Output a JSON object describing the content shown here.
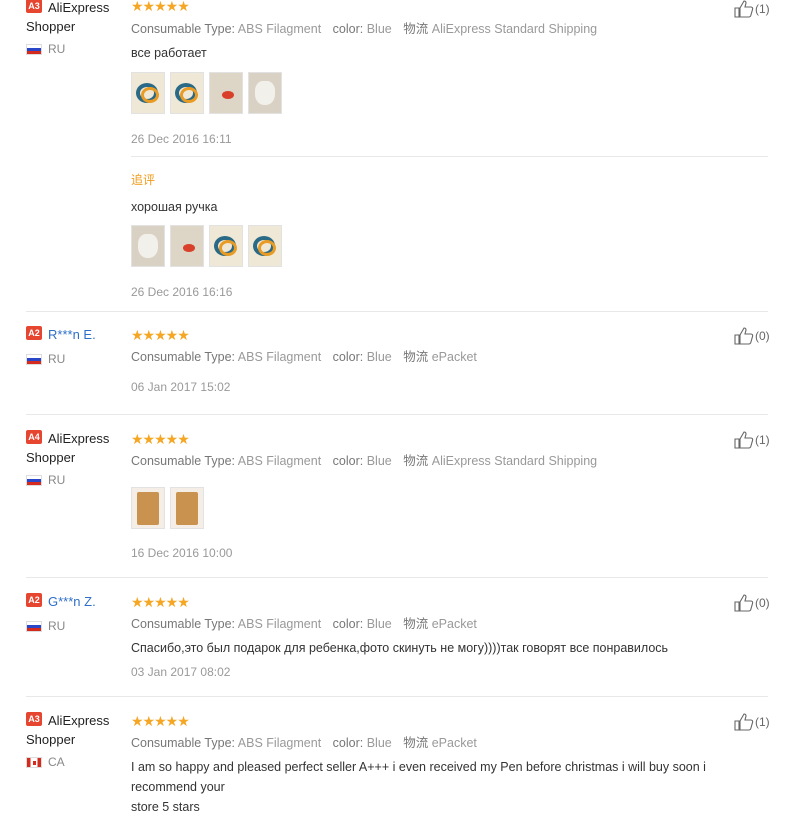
{
  "labels": {
    "consumable_type": "Consumable Type:",
    "color": "color:",
    "shipping": "物流"
  },
  "colors": {
    "stars": "#f5a623",
    "level_badge": "#e6452f",
    "masked_name": "#2e6fc7",
    "followup": "#f09b1a"
  },
  "reviews": [
    {
      "level": "A3",
      "name_line1": "AliExpress",
      "name_line2": "Shopper",
      "country": "RU",
      "flag": "ru",
      "stars": "★★★★★",
      "consumable": "ABS Filagment",
      "color": "Blue",
      "shipping": "AliExpress Standard Shipping",
      "text": "все работает",
      "date": "26 Dec 2016 16:11",
      "likes": "(1)",
      "photos": [
        "filament-photo",
        "filament-photo",
        "pen-drawing-photo",
        "cat-drawing-photo"
      ],
      "followup": {
        "label": "追评",
        "text": "хорошая ручка",
        "date": "26 Dec 2016 16:16",
        "photos": [
          "cat-drawing-photo",
          "pen-drawing-photo",
          "filament-photo",
          "filament-photo"
        ]
      }
    },
    {
      "level": "A2",
      "name_line1": "R***n E.",
      "name_line2": "",
      "country": "RU",
      "flag": "ru",
      "stars": "★★★★★",
      "consumable": "ABS Filagment",
      "color": "Blue",
      "shipping": "ePacket",
      "text": "",
      "date": "06 Jan 2017 15:02",
      "likes": "(0)",
      "photos": []
    },
    {
      "level": "A4",
      "name_line1": "AliExpress",
      "name_line2": "Shopper",
      "country": "RU",
      "flag": "ru",
      "stars": "★★★★★",
      "consumable": "ABS Filagment",
      "color": "Blue",
      "shipping": "AliExpress Standard Shipping",
      "text": "",
      "date": "16 Dec 2016 10:00",
      "likes": "(1)",
      "photos": [
        "package-photo",
        "package-photo"
      ]
    },
    {
      "level": "A2",
      "name_line1": "G***n Z.",
      "name_line2": "",
      "country": "RU",
      "flag": "ru",
      "stars": "★★★★★",
      "consumable": "ABS Filagment",
      "color": "Blue",
      "shipping": "ePacket",
      "text": "Спасибо,это был подарок для ребенка,фото скинуть не могу))))так говорят все понравилось",
      "date": "03 Jan 2017 08:02",
      "likes": "(0)",
      "photos": []
    },
    {
      "level": "A3",
      "name_line1": "AliExpress",
      "name_line2": "Shopper",
      "country": "CA",
      "flag": "ca",
      "stars": "★★★★★",
      "consumable": "ABS Filagment",
      "color": "Blue",
      "shipping": "ePacket",
      "text_line1": "I am so happy and pleased perfect seller A+++ i even received my Pen before christmas i will buy soon i recommend your",
      "text_line2": "store 5 stars",
      "likes": "(1)",
      "photos": []
    }
  ]
}
